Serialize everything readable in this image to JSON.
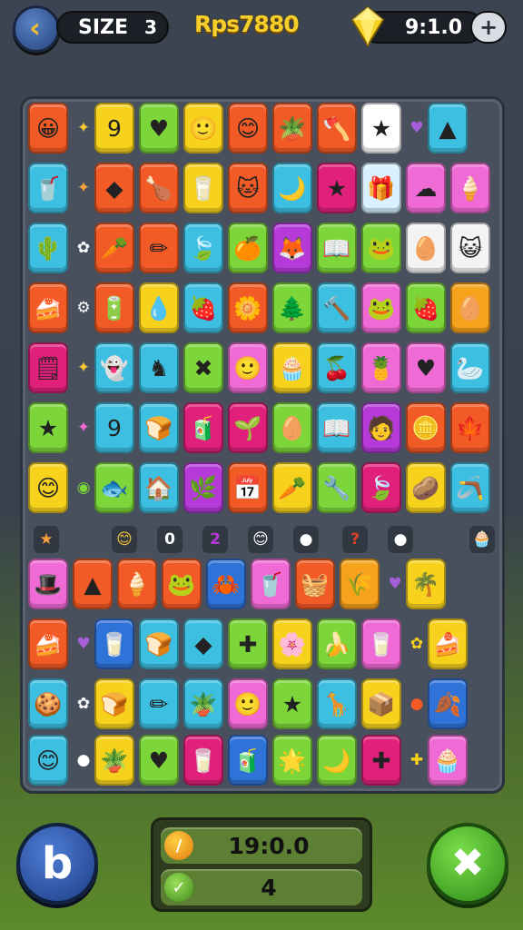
{
  "header": {
    "back_icon": "back-arrow-icon",
    "size_label": "SIZE",
    "size_value": "3",
    "score": "Rps7880",
    "gem_icon": "yellow-gem-icon",
    "gem_value": "9:1.0",
    "plus_label": "+"
  },
  "board": {
    "rows": [
      {
        "tiles": [
          {
            "color": "#f25a26",
            "glyph": "😀"
          },
          {
            "spark": "#f7c43a",
            "glyph": "✦"
          },
          {
            "color": "#f6d21d",
            "glyph": "9"
          },
          {
            "color": "#7cd63a",
            "glyph": "♥"
          },
          {
            "color": "#f6d21d",
            "glyph": "🙂"
          },
          {
            "color": "#f25a26",
            "glyph": "😊"
          },
          {
            "color": "#f25a26",
            "glyph": "🪴"
          },
          {
            "color": "#f25a26",
            "glyph": "🪓"
          },
          {
            "color": "#ffffff",
            "glyph": "★"
          },
          {
            "spark": "#a65fd8",
            "glyph": "♥"
          },
          {
            "color": "#3cbfe0",
            "glyph": "▲"
          }
        ]
      },
      {
        "tiles": [
          {
            "color": "#3cbfe0",
            "glyph": "🥤"
          },
          {
            "spark": "#f7a13a",
            "glyph": "✦"
          },
          {
            "color": "#f25a26",
            "glyph": "◆"
          },
          {
            "color": "#f25a26",
            "glyph": "🍗"
          },
          {
            "color": "#f6d21d",
            "glyph": "🥛"
          },
          {
            "color": "#f25a26",
            "glyph": "🐱"
          },
          {
            "color": "#3cbfe0",
            "glyph": "🌙"
          },
          {
            "color": "#e0207a",
            "glyph": "★"
          },
          {
            "color": "#d8f0ff",
            "glyph": "🎁"
          },
          {
            "color": "#f06ad6",
            "glyph": "☁"
          },
          {
            "color": "#f06ad6",
            "glyph": "🍦"
          }
        ]
      },
      {
        "tiles": [
          {
            "color": "#3cbfe0",
            "glyph": "🌵"
          },
          {
            "spark": "#ffffff",
            "glyph": "✿"
          },
          {
            "color": "#f25a26",
            "glyph": "🥕"
          },
          {
            "color": "#f25a26",
            "glyph": "✏"
          },
          {
            "color": "#3cbfe0",
            "glyph": "🍃"
          },
          {
            "color": "#7cd63a",
            "glyph": "🍊"
          },
          {
            "color": "#b53ad8",
            "glyph": "🦊"
          },
          {
            "color": "#7cd63a",
            "glyph": "📖"
          },
          {
            "color": "#7cd63a",
            "glyph": "🐸"
          },
          {
            "color": "#f3f3f3",
            "glyph": "🥚"
          },
          {
            "color": "#f3f3f3",
            "glyph": "😺"
          }
        ]
      },
      {
        "tiles": [
          {
            "color": "#f25a26",
            "glyph": "🍰"
          },
          {
            "spark": "#ffffff",
            "glyph": "⚙"
          },
          {
            "color": "#f25a26",
            "glyph": "🔋"
          },
          {
            "color": "#f6d21d",
            "glyph": "💧"
          },
          {
            "color": "#3cbfe0",
            "glyph": "🍓"
          },
          {
            "color": "#f25a26",
            "glyph": "🌼"
          },
          {
            "color": "#7cd63a",
            "glyph": "🌲"
          },
          {
            "color": "#3cbfe0",
            "glyph": "🔨"
          },
          {
            "color": "#f06ad6",
            "glyph": "🐸"
          },
          {
            "color": "#7cd63a",
            "glyph": "🍓"
          },
          {
            "color": "#f6a21d",
            "glyph": "🥚"
          }
        ]
      },
      {
        "tiles": [
          {
            "color": "#e0207a",
            "glyph": "🗒"
          },
          {
            "spark": "#f7c43a",
            "glyph": "✦"
          },
          {
            "color": "#3cbfe0",
            "glyph": "👻"
          },
          {
            "color": "#3cbfe0",
            "glyph": "♞"
          },
          {
            "color": "#7cd63a",
            "glyph": "✖"
          },
          {
            "color": "#f06ad6",
            "glyph": "🙂"
          },
          {
            "color": "#f6d21d",
            "glyph": "🧁"
          },
          {
            "color": "#3cbfe0",
            "glyph": "🍒"
          },
          {
            "color": "#f06ad6",
            "glyph": "🍍"
          },
          {
            "color": "#f06ad6",
            "glyph": "♥"
          },
          {
            "color": "#3cbfe0",
            "glyph": "🦢"
          }
        ]
      },
      {
        "tiles": [
          {
            "color": "#7cd63a",
            "glyph": "★"
          },
          {
            "spark": "#f06ad6",
            "glyph": "✦"
          },
          {
            "color": "#3cbfe0",
            "glyph": "9"
          },
          {
            "color": "#3cbfe0",
            "glyph": "🍞"
          },
          {
            "color": "#e0207a",
            "glyph": "🧃"
          },
          {
            "color": "#e0207a",
            "glyph": "🌱"
          },
          {
            "color": "#7cd63a",
            "glyph": "🥚"
          },
          {
            "color": "#3cbfe0",
            "glyph": "📖"
          },
          {
            "color": "#b53ad8",
            "glyph": "🧑"
          },
          {
            "color": "#f25a26",
            "glyph": "🪙"
          },
          {
            "color": "#f25a26",
            "glyph": "🍁"
          }
        ]
      },
      {
        "tiles": [
          {
            "color": "#f6d21d",
            "glyph": "😊"
          },
          {
            "spark": "#7cd63a",
            "glyph": "◉"
          },
          {
            "color": "#7cd63a",
            "glyph": "🐟"
          },
          {
            "color": "#3cbfe0",
            "glyph": "🏠"
          },
          {
            "color": "#b53ad8",
            "glyph": "🌿"
          },
          {
            "color": "#f25a26",
            "glyph": "📅"
          },
          {
            "color": "#f6d21d",
            "glyph": "🥕"
          },
          {
            "color": "#7cd63a",
            "glyph": "🔧"
          },
          {
            "color": "#e0207a",
            "glyph": "🍃"
          },
          {
            "color": "#f6d21d",
            "glyph": "🥔"
          },
          {
            "color": "#3cbfe0",
            "glyph": "🪃"
          }
        ]
      }
    ],
    "slot_row": [
      {
        "glyph": "★"
      },
      {
        "glyph": "😊"
      },
      {
        "glyph": "0"
      },
      {
        "glyph": "2"
      },
      {
        "glyph": "😊"
      },
      {
        "glyph": "●"
      },
      {
        "glyph": "?"
      },
      {
        "glyph": "●"
      },
      {
        "glyph": "🧁"
      }
    ],
    "lower_rows": [
      {
        "tiles": [
          {
            "color": "#f06ad6",
            "glyph": "🎩"
          },
          {
            "color": "#f25a26",
            "glyph": "▲"
          },
          {
            "color": "#f25a26",
            "glyph": "🍦"
          },
          {
            "color": "#f25a26",
            "glyph": "🐸"
          },
          {
            "color": "#2f72d8",
            "glyph": "🦀"
          },
          {
            "color": "#f06ad6",
            "glyph": "🥤"
          },
          {
            "color": "#f25a26",
            "glyph": "🧺"
          },
          {
            "color": "#f6a21d",
            "glyph": "🌾"
          },
          {
            "spark": "#a65fd8",
            "glyph": "♥"
          },
          {
            "color": "#f6d21d",
            "glyph": "🌴"
          }
        ]
      },
      {
        "tiles": [
          {
            "color": "#f25a26",
            "glyph": "🍰"
          },
          {
            "spark": "#a65fd8",
            "glyph": "♥"
          },
          {
            "color": "#2f72d8",
            "glyph": "🥛"
          },
          {
            "color": "#3cbfe0",
            "glyph": "🍞"
          },
          {
            "color": "#3cbfe0",
            "glyph": "◆"
          },
          {
            "color": "#7cd63a",
            "glyph": "✚"
          },
          {
            "color": "#f6d21d",
            "glyph": "🌸"
          },
          {
            "color": "#7cd63a",
            "glyph": "🍌"
          },
          {
            "color": "#f06ad6",
            "glyph": "🥛"
          },
          {
            "spark": "#f6d21d",
            "glyph": "✿"
          },
          {
            "color": "#f6d21d",
            "glyph": "🍰"
          }
        ]
      },
      {
        "tiles": [
          {
            "color": "#3cbfe0",
            "glyph": "🍪"
          },
          {
            "spark": "#ffffff",
            "glyph": "✿"
          },
          {
            "color": "#f6d21d",
            "glyph": "🍞"
          },
          {
            "color": "#3cbfe0",
            "glyph": "✏"
          },
          {
            "color": "#3cbfe0",
            "glyph": "🪴"
          },
          {
            "color": "#f06ad6",
            "glyph": "🙂"
          },
          {
            "color": "#7cd63a",
            "glyph": "★"
          },
          {
            "color": "#3cbfe0",
            "glyph": "🦒"
          },
          {
            "color": "#f6d21d",
            "glyph": "📦"
          },
          {
            "spark": "#f25a26",
            "glyph": "●"
          },
          {
            "color": "#2f72d8",
            "glyph": "🍂"
          }
        ]
      },
      {
        "tiles": [
          {
            "color": "#3cbfe0",
            "glyph": "😊"
          },
          {
            "spark": "#ffffff",
            "glyph": "●"
          },
          {
            "color": "#f6d21d",
            "glyph": "🪴"
          },
          {
            "color": "#7cd63a",
            "glyph": "♥"
          },
          {
            "color": "#e0207a",
            "glyph": "🥛"
          },
          {
            "color": "#2f72d8",
            "glyph": "🧃"
          },
          {
            "color": "#7cd63a",
            "glyph": "🌟"
          },
          {
            "color": "#7cd63a",
            "glyph": "🌙"
          },
          {
            "color": "#e0207a",
            "glyph": "✚"
          },
          {
            "spark": "#f6d21d",
            "glyph": "✚"
          },
          {
            "color": "#f06ad6",
            "glyph": "🧁"
          }
        ]
      }
    ]
  },
  "footer": {
    "left_button_icon": "b-logo-icon",
    "left_button_glyph": "b",
    "coin_icon": "coin-icon",
    "coin_value": "19:0.0",
    "check_icon": "check-icon",
    "moves_value": "4",
    "right_button_icon": "close-icon"
  }
}
